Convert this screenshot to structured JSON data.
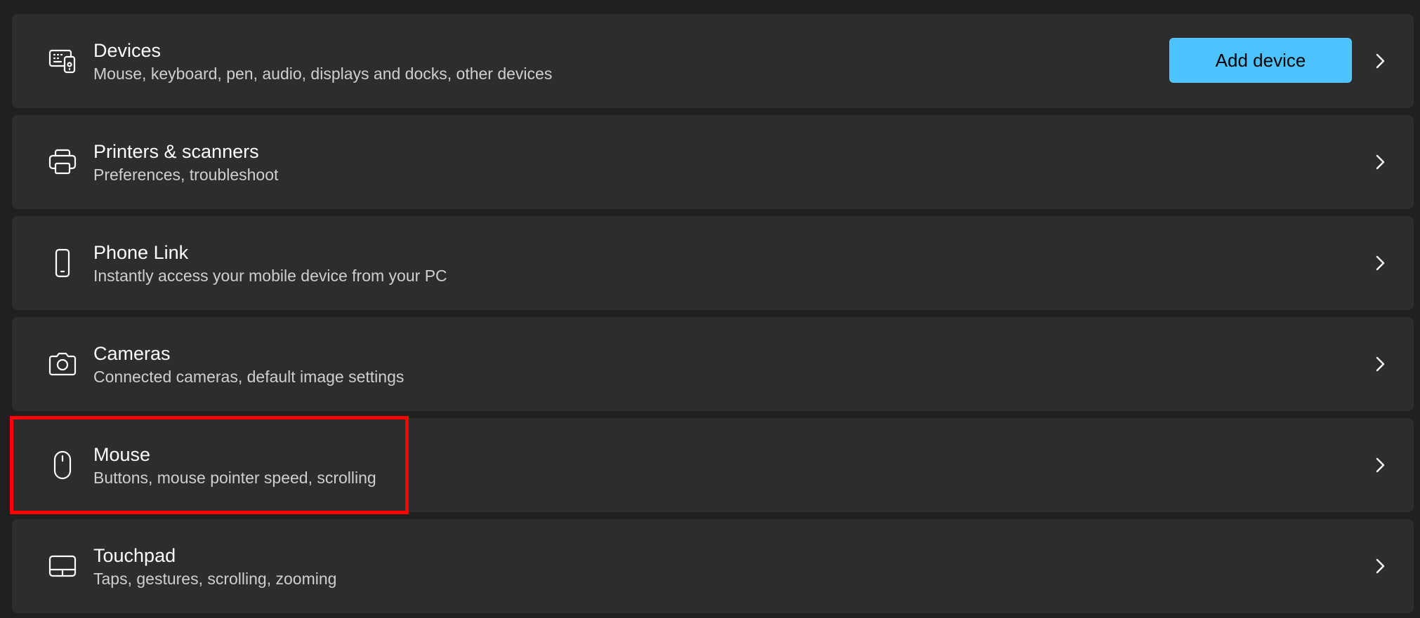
{
  "devices": {
    "title": "Devices",
    "description": "Mouse, keyboard, pen, audio, displays and docks, other devices",
    "icon": "devices-icon",
    "button_label": "Add device"
  },
  "printers": {
    "title": "Printers & scanners",
    "description": "Preferences, troubleshoot",
    "icon": "printer-icon"
  },
  "phone_link": {
    "title": "Phone Link",
    "description": "Instantly access your mobile device from your PC",
    "icon": "phone-icon"
  },
  "cameras": {
    "title": "Cameras",
    "description": "Connected cameras, default image settings",
    "icon": "camera-icon"
  },
  "mouse": {
    "title": "Mouse",
    "description": "Buttons, mouse pointer speed, scrolling",
    "icon": "mouse-icon"
  },
  "touchpad": {
    "title": "Touchpad",
    "description": "Taps, gestures, scrolling, zooming",
    "icon": "touchpad-icon"
  },
  "colors": {
    "background": "#202020",
    "card": "#2d2d2d",
    "accent": "#4cc2ff",
    "highlight": "#ff0000"
  }
}
